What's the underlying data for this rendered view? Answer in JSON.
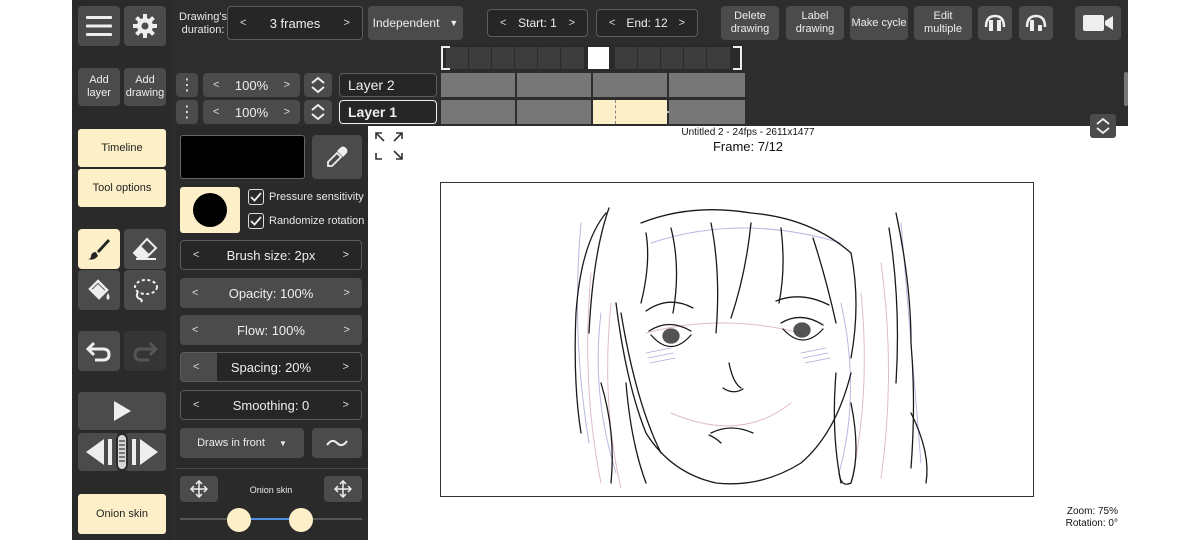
{
  "top_bar": {
    "duration_label": "Drawing's duration:",
    "duration_value": "3 frames",
    "mode": "Independent",
    "start": "Start: 1",
    "end": "End: 12",
    "delete_drawing": "Delete drawing",
    "label_drawing": "Label drawing",
    "make_cycle": "Make cycle",
    "edit_multiple": "Edit multiple"
  },
  "left_toolbar": {
    "add_layer": "Add layer",
    "add_drawing": "Add drawing",
    "timeline": "Timeline",
    "tool_options": "Tool options",
    "onion_skin": "Onion skin"
  },
  "layers": [
    {
      "opacity": "100%",
      "name": "Layer 2"
    },
    {
      "opacity": "100%",
      "name": "Layer 1"
    }
  ],
  "tool_options": {
    "pressure_sensitivity": "Pressure sensitivity",
    "randomize_rotation": "Randomize rotation",
    "brush_size": "Brush size:  2px",
    "opacity": "Opacity:  100%",
    "flow": "Flow:  100%",
    "spacing": "Spacing:  20%",
    "smoothing": "Smoothing:  0",
    "draw_order": "Draws in front",
    "onion_skin_label": "Onion skin"
  },
  "canvas": {
    "doc_info": "Untitled 2 - 24fps - 2611x1477",
    "frame": "Frame: 7/12",
    "zoom": "Zoom: 75%",
    "rotation": "Rotation: 0°"
  },
  "colors": {
    "accent": "#fdf0c9",
    "panel": "#2d2d2d",
    "button": "#4b4b4b",
    "slider": "#4f8fe0",
    "current_color": "#000000"
  }
}
